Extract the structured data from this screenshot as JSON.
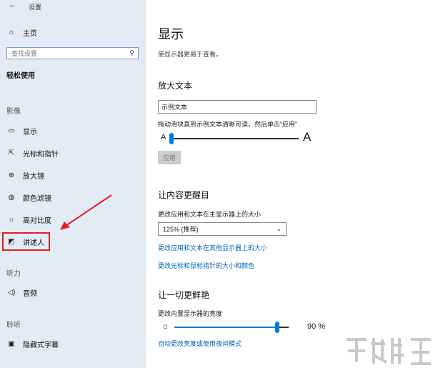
{
  "window": {
    "title": "设置",
    "back_icon": "back-arrow-icon"
  },
  "sidebar": {
    "home_label": "主页",
    "search_placeholder": "查找设置",
    "section_heading": "轻松使用",
    "groups": [
      {
        "label": "影像",
        "items": [
          {
            "label": "显示",
            "icon": "monitor-icon"
          },
          {
            "label": "光标和指针",
            "icon": "cursor-icon"
          },
          {
            "label": "放大镜",
            "icon": "magnifier-icon"
          },
          {
            "label": "颜色滤镜",
            "icon": "palette-icon"
          },
          {
            "label": "高对比度",
            "icon": "contrast-icon"
          },
          {
            "label": "讲述人",
            "icon": "narrator-icon",
            "highlighted": true
          }
        ]
      },
      {
        "label": "听力",
        "items": [
          {
            "label": "音频",
            "icon": "speaker-icon"
          }
        ]
      },
      {
        "label": "聆听",
        "items": [
          {
            "label": "隐藏式字幕",
            "icon": "caption-icon"
          }
        ]
      }
    ]
  },
  "main": {
    "title": "显示",
    "subtitle": "使显示器更易于查看。",
    "enlarge_text": {
      "heading": "放大文本",
      "sample_value": "示例文本",
      "hint": "拖动滑块直到示例文本清晰可读，然后单击“应用”",
      "small_a": "A",
      "large_a": "A",
      "slider_level": 0.0,
      "apply_label": "应用"
    },
    "make_bigger": {
      "heading": "让内容更醒目",
      "label": "更改应用和文本在主显示器上的大小",
      "dropdown_value": "125% (推荐)",
      "link1": "更改应用和文本在其他显示器上的大小",
      "link2": "更改光标和鼠标指针的大小和颜色"
    },
    "brighter": {
      "heading": "让一切更鲜艳",
      "label": "更改内置显示器的亮度",
      "brightness_value": "90 %",
      "brightness_level": 0.9,
      "link": "自动更改亮度或使用夜间模式"
    }
  },
  "colors": {
    "accent": "#0078d7",
    "sidebar_bg": "#e3ebf5",
    "highlight": "#e02020"
  }
}
